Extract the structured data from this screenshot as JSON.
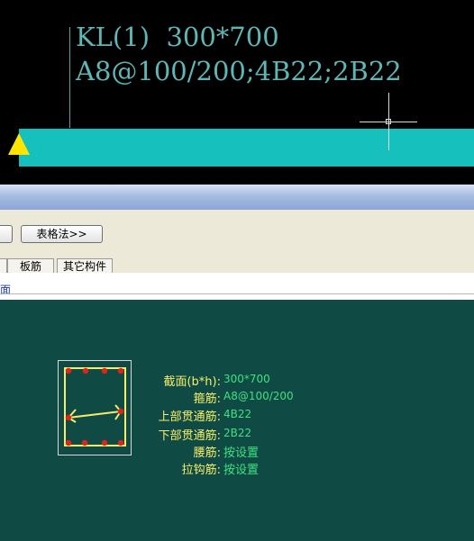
{
  "cad": {
    "annotation_line1": "KL(1)  300*700",
    "annotation_line2": "A8@100/200;4B22;2B22",
    "colors": {
      "beam": "#16c0bd",
      "text": "#5fb7b5",
      "marker": "#ffe400",
      "background": "#000000"
    }
  },
  "toolbar": {
    "table_button": "表格法>>"
  },
  "tabs": [
    {
      "label": "板筋"
    },
    {
      "label": "其它构件"
    }
  ],
  "section_label": "面",
  "section": {
    "properties": [
      {
        "label": "截面(b*h):",
        "value": "300*700"
      },
      {
        "label": "箍筋:",
        "value": "A8@100/200"
      },
      {
        "label": "上部贯通筋:",
        "value": "4B22"
      },
      {
        "label": "下部贯通筋:",
        "value": "2B22"
      },
      {
        "label": "腰筋:",
        "value": "按设置"
      },
      {
        "label": "拉钩筋:",
        "value": "按设置"
      }
    ],
    "colors": {
      "panel": "#0f4a45",
      "label": "#f6ee6a",
      "value": "#3ee27e",
      "rebar": "#e0241b"
    }
  }
}
